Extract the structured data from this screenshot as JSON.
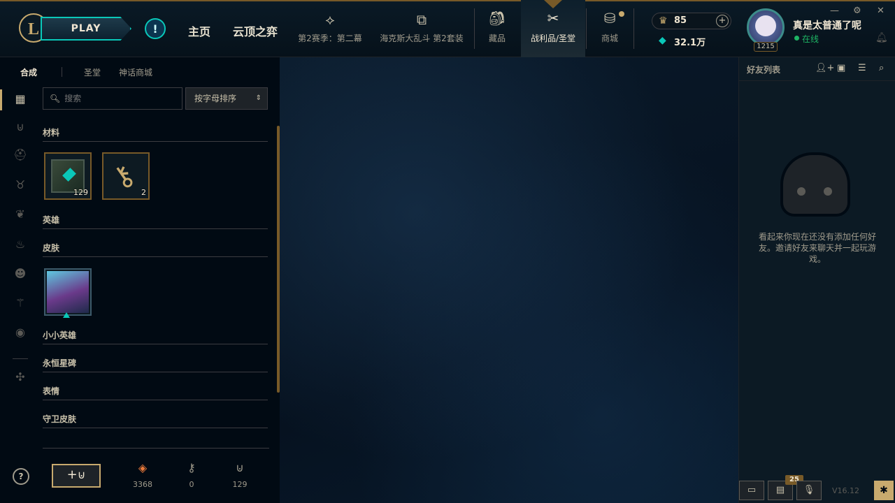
{
  "header": {
    "play_label": "PLAY",
    "alert_label": "!",
    "nav_main": [
      "主页",
      "云顶之弈"
    ],
    "modes": [
      {
        "label": "第2赛季：第二幕",
        "icon": "cards-icon"
      },
      {
        "label": "海克斯大乱斗 第2套装",
        "icon": "dice-icon"
      }
    ],
    "sections": [
      {
        "label": "藏品",
        "icon": "bag-icon"
      },
      {
        "label": "战利品/圣堂",
        "icon": "loot-icon"
      },
      {
        "label": "商城",
        "icon": "coins-icon"
      }
    ],
    "active_section": "战利品/圣堂",
    "rp": "85",
    "be": "32.1万",
    "level": "1215",
    "username": "真是太普通了呢",
    "status": "在线"
  },
  "subtabs": [
    "合成",
    "圣堂",
    "神话商城"
  ],
  "active_subtab": "合成",
  "search": {
    "placeholder": "搜索"
  },
  "sort": {
    "value": "按字母排序"
  },
  "sections": {
    "materials": "材料",
    "champions": "英雄",
    "skins": "皮肤",
    "little_legends": "小小英雄",
    "eternals": "永恒星碑",
    "emotes": "表情",
    "ward_skins": "守卫皮肤"
  },
  "loot_items": {
    "chest_count": "129",
    "key_count": "2"
  },
  "resources": {
    "essence": "3368",
    "keys": "0",
    "chests": "129"
  },
  "craft_label": "+",
  "friends": {
    "title": "好友列表",
    "empty_text": "看起来你现在还没有添加任何好友。邀请好友来聊天并一起玩游戏。"
  },
  "bottom": {
    "badge": "25",
    "version": "V16.12",
    "help": "?"
  },
  "colors": {
    "gold": "#c8aa6e",
    "teal": "#0ac8b9",
    "online": "#1eb464"
  }
}
